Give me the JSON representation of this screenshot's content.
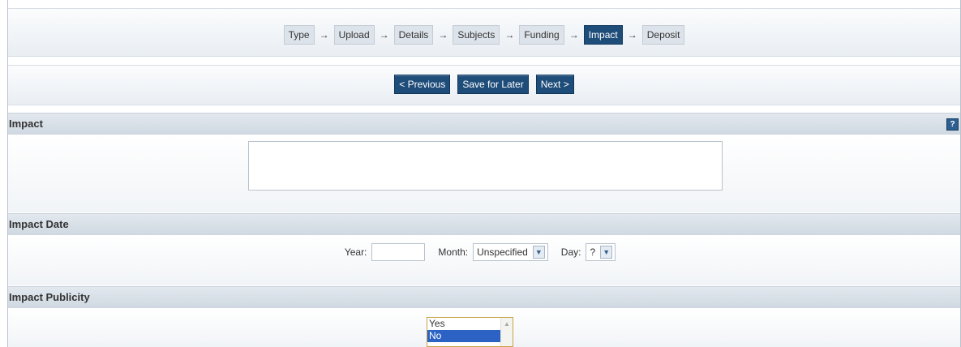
{
  "wizard": {
    "steps": [
      {
        "label": "Type",
        "active": false
      },
      {
        "label": "Upload",
        "active": false
      },
      {
        "label": "Details",
        "active": false
      },
      {
        "label": "Subjects",
        "active": false
      },
      {
        "label": "Funding",
        "active": false
      },
      {
        "label": "Impact",
        "active": true
      },
      {
        "label": "Deposit",
        "active": false
      }
    ],
    "arrow_glyph": "→"
  },
  "nav": {
    "previous_label": "< Previous",
    "save_label": "Save for Later",
    "next_label": "Next >"
  },
  "impact": {
    "heading": "Impact",
    "help_icon": "help-icon",
    "help_glyph": "?",
    "value": ""
  },
  "impact_date": {
    "heading": "Impact Date",
    "year_label": "Year:",
    "year_value": "",
    "month_label": "Month:",
    "month_value": "Unspecified",
    "day_label": "Day:",
    "day_value": "?"
  },
  "impact_publicity": {
    "heading": "Impact Publicity",
    "options": [
      "Yes",
      "No"
    ],
    "selected": "No"
  },
  "colors": {
    "accent": "#1f4d7a",
    "selected_option": "#2b62c4"
  }
}
